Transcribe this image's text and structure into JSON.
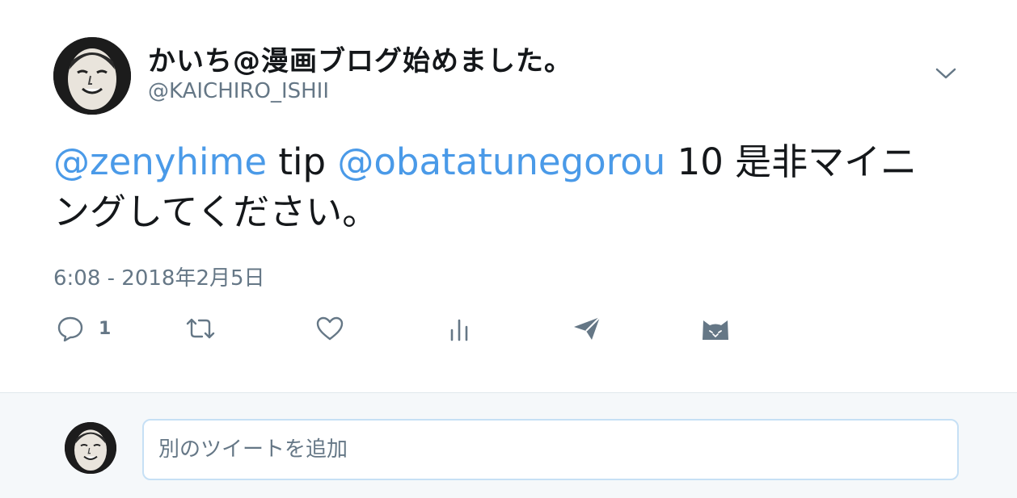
{
  "author": {
    "display_name": "かいち@漫画ブログ始めました。",
    "handle": "@KAICHIRO_ISHII"
  },
  "tweet": {
    "segments": [
      {
        "type": "mention",
        "text": "@zenyhime"
      },
      {
        "type": "text",
        "text": " tip "
      },
      {
        "type": "mention",
        "text": "@obatatunegorou"
      },
      {
        "type": "text",
        "text": " 10 是非マイニングしてください。"
      }
    ],
    "timestamp": "6:08 - 2018年2月5日"
  },
  "actions": {
    "reply_count": "1",
    "icons": [
      "reply-icon",
      "retweet-icon",
      "like-icon",
      "analytics-icon",
      "direct-message-icon",
      "cat-icon"
    ]
  },
  "composer": {
    "placeholder": "別のツイートを追加"
  },
  "colors": {
    "mention": "#4a9ae8",
    "muted": "#657786",
    "icon": "#657786",
    "text": "#14171a",
    "composer_bg": "#f5f8fa",
    "input_border": "#c6e0f5"
  }
}
